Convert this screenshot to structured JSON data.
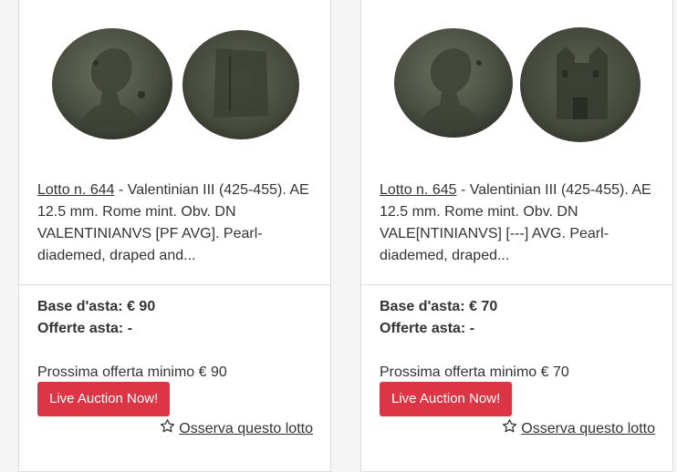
{
  "lots": [
    {
      "link": "Lotto n. 644",
      "description": " - Valentinian III (425-455). AE 12.5 mm. Rome mint. Obv. DN VALENTINIANVS [PF AVG]. Pearl-diademed, draped and...",
      "base_label": "Base d'asta:",
      "base_value": "€ 90",
      "offers_label": "Offerte asta:",
      "offers_value": "-",
      "next_offer": "Prossima offerta minimo € 90",
      "live_button": "Live Auction Now!",
      "watch_label": " Osserva questo lotto"
    },
    {
      "link": "Lotto n. 645",
      "description": " - Valentinian III (425-455). AE 12.5 mm. Rome mint. Obv. DN VALE[NTINIANVS] [---] AVG. Pearl-diademed, draped...",
      "base_label": "Base d'asta:",
      "base_value": "€ 70",
      "offers_label": "Offerte asta:",
      "offers_value": "-",
      "next_offer": "Prossima offerta minimo € 70",
      "live_button": "Live Auction Now!",
      "watch_label": " Osserva questo lotto"
    }
  ],
  "colors": {
    "button": "#dc3545",
    "coin_dark": "#3b4034",
    "coin_mid": "#5c6150"
  },
  "icons": {
    "watch": "star-outline-icon"
  }
}
